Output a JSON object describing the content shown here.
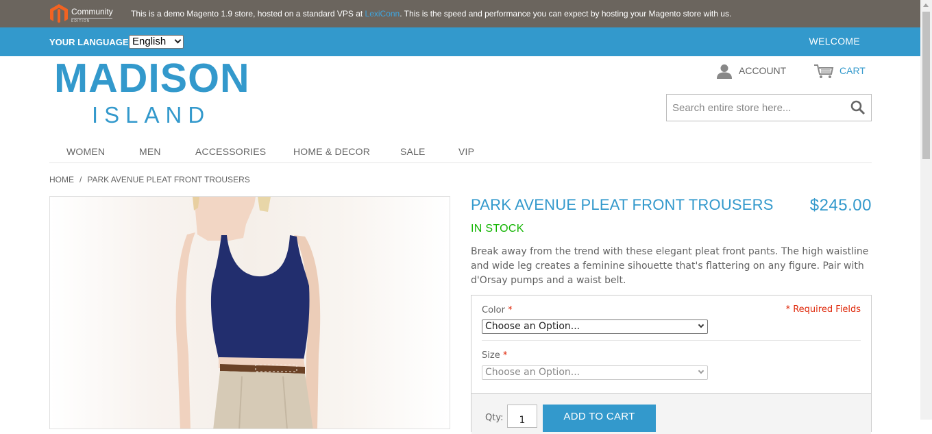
{
  "demo_bar": {
    "logo_text": "Community",
    "logo_sub": "EDITION",
    "message_pre": "This is a demo Magento 1.9 store, hosted on a standard VPS at ",
    "message_link": "LexiConn",
    "message_post": ". This is the speed and performance you can expect by hosting your Magento store with us."
  },
  "lang_bar": {
    "label": "YOUR LANGUAGE:",
    "selected_language": "English",
    "welcome": "WELCOME"
  },
  "header": {
    "logo_main": "MADISON",
    "logo_sub": "ISLAND",
    "account_label": "ACCOUNT",
    "cart_label": "CART",
    "search_placeholder": "Search entire store here..."
  },
  "nav": {
    "items": [
      "WOMEN",
      "MEN",
      "ACCESSORIES",
      "HOME & DECOR",
      "SALE",
      "VIP"
    ]
  },
  "breadcrumb": {
    "home": "HOME",
    "separator": "/",
    "current": "PARK AVENUE PLEAT FRONT TROUSERS"
  },
  "product": {
    "name": "PARK AVENUE PLEAT FRONT TROUSERS",
    "price": "$245.00",
    "stock": "IN STOCK",
    "description": "Break away from the trend with these elegant pleat front pants. The high waistline and wide leg creates a feminine sihouette that's flattering on any figure. Pair with d'Orsay pumps and a waist belt."
  },
  "options": {
    "required_note": "* Required Fields",
    "color_label": "Color",
    "color_value": "Choose an Option...",
    "size_label": "Size",
    "size_value": "Choose an Option...",
    "required_star": "*",
    "qty_label": "Qty:",
    "qty_value": "1",
    "add_to_cart": "ADD TO CART"
  },
  "colors": {
    "brand_blue": "#3399cc",
    "demo_bar": "#6b655e",
    "in_stock": "#11b400",
    "required": "#df280a"
  }
}
